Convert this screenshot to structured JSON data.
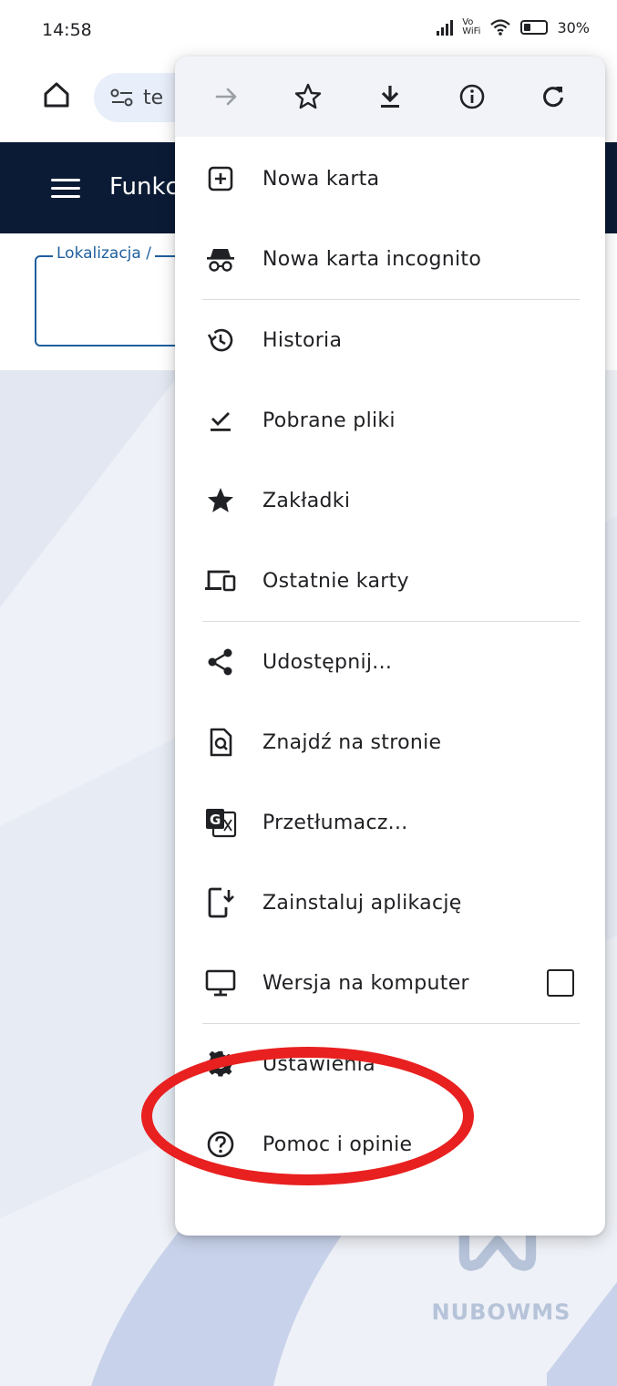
{
  "status": {
    "time": "14:58",
    "network": "Vo WiFi",
    "battery": "30%"
  },
  "toolbar": {
    "url_fragment": "te",
    "icons": [
      "home-icon",
      "site-info-icon"
    ]
  },
  "site": {
    "title": "Funkc",
    "field_label": "Lokalizacja /"
  },
  "menu": {
    "top_icons": [
      "forward-icon",
      "star-outline-icon",
      "download-icon",
      "info-icon",
      "refresh-icon"
    ],
    "items": [
      {
        "label": "Nowa karta",
        "icon": "new-tab-icon"
      },
      {
        "label": "Nowa karta incognito",
        "icon": "incognito-icon"
      },
      {
        "label": "Historia",
        "icon": "history-icon"
      },
      {
        "label": "Pobrane pliki",
        "icon": "downloads-check-icon"
      },
      {
        "label": "Zakładki",
        "icon": "star-filled-icon"
      },
      {
        "label": "Ostatnie karty",
        "icon": "devices-icon"
      },
      {
        "label": "Udostępnij...",
        "icon": "share-icon"
      },
      {
        "label": "Znajdź na stronie",
        "icon": "find-in-page-icon"
      },
      {
        "label": "Przetłumacz...",
        "icon": "translate-icon"
      },
      {
        "label": "Zainstaluj aplikację",
        "icon": "install-app-icon"
      },
      {
        "label": "Wersja na komputer",
        "icon": "desktop-icon",
        "checked": false
      },
      {
        "label": "Ustawienia",
        "icon": "settings-gear-icon"
      },
      {
        "label": "Pomoc i opinie",
        "icon": "help-icon"
      }
    ]
  },
  "brand": {
    "name": "NUBOWMS"
  },
  "colors": {
    "header_bg": "#0b1b35",
    "field_border": "#1f5f9e",
    "annotation": "#e8201f",
    "omnibox_bg": "#e8eefa"
  }
}
